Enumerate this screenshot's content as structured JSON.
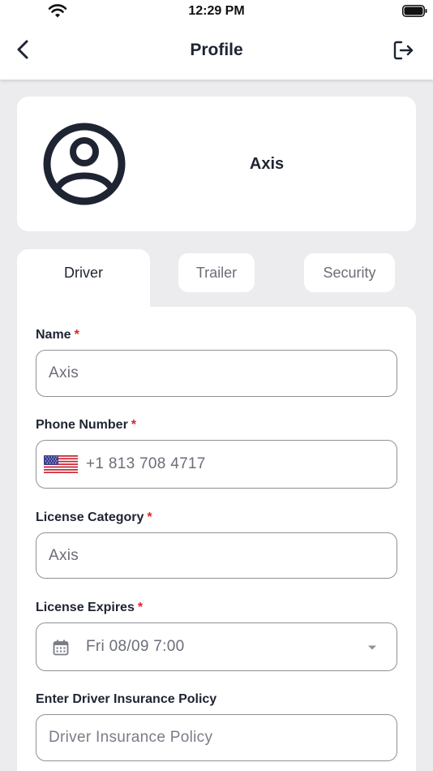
{
  "status_bar": {
    "time": "12:29 PM"
  },
  "nav": {
    "title": "Profile"
  },
  "profile": {
    "name": "Axis"
  },
  "tabs": [
    {
      "label": "Driver",
      "active": true
    },
    {
      "label": "Trailer",
      "active": false
    },
    {
      "label": "Security",
      "active": false
    }
  ],
  "form": {
    "name": {
      "label": "Name",
      "required_mark": "*",
      "value": "Axis"
    },
    "phone": {
      "label": "Phone Number",
      "required_mark": "*",
      "value": "+1 813 708 4717"
    },
    "license_category": {
      "label": "License Category",
      "required_mark": "*",
      "value": "Axis"
    },
    "license_expires": {
      "label": "License Expires",
      "required_mark": "*",
      "value": "Fri 08/09 7:00"
    },
    "insurance": {
      "label": "Enter Driver Insurance Policy",
      "placeholder": "Driver Insurance Policy"
    }
  },
  "colors": {
    "accent_dark": "#1f2433",
    "required": "#e02424",
    "background": "#ececee"
  },
  "icons": [
    "wifi-icon",
    "battery-icon",
    "back-arrow-icon",
    "logout-icon",
    "user-avatar-icon",
    "us-flag-icon",
    "calendar-icon",
    "caret-down-icon"
  ]
}
